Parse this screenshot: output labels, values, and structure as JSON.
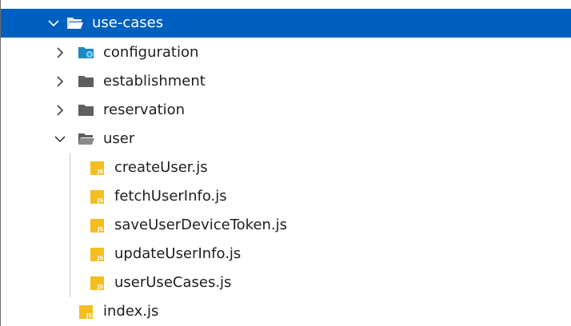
{
  "tree": {
    "use_cases": {
      "label": "use-cases",
      "expanded": true,
      "selected": true
    },
    "configuration": {
      "label": "configuration",
      "expanded": false,
      "icon": "config-folder-icon"
    },
    "establishment": {
      "label": "establishment",
      "expanded": false
    },
    "reservation": {
      "label": "reservation",
      "expanded": false
    },
    "user": {
      "label": "user",
      "expanded": true,
      "files": [
        {
          "label": "createUser.js"
        },
        {
          "label": "fetchUserInfo.js"
        },
        {
          "label": "saveUserDeviceToken.js"
        },
        {
          "label": "updateUserInfo.js"
        },
        {
          "label": "userUseCases.js"
        }
      ]
    },
    "index": {
      "label": "index.js"
    },
    "js_badge": "JS"
  },
  "colors": {
    "selection": "#0060c0",
    "folder": "#5f5f5f",
    "js_icon": "#f5bd1f",
    "text": "#1e1e1e"
  }
}
